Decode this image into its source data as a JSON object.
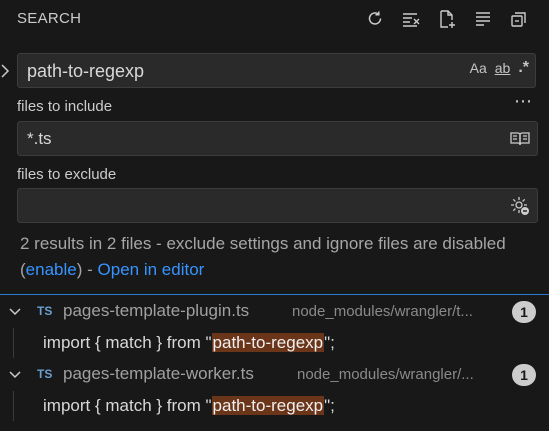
{
  "header": {
    "title": "SEARCH",
    "actions": [
      "refresh-icon",
      "clear-results-icon",
      "new-search-editor-icon",
      "view-as-tree-icon",
      "collapse-all-icon"
    ]
  },
  "search": {
    "query": "path-to-regexp",
    "match_case_label": "Aa",
    "whole_word_label": "ab",
    "regex_label": ".*"
  },
  "more_label": "⋯",
  "include": {
    "label": "files to include",
    "value": "*.ts"
  },
  "exclude": {
    "label": "files to exclude",
    "value": ""
  },
  "message": {
    "text": "2 results in 2 files - exclude settings and ignore files are disabled (",
    "enable_link": "enable",
    "middle": ") - ",
    "open_link": "Open in editor"
  },
  "results": [
    {
      "lang": "TS",
      "file": "pages-template-plugin.ts",
      "path": "node_modules/wrangler/t...",
      "count": "1",
      "line_prefix": "import { match } from \"",
      "match": "path-to-regexp",
      "line_suffix": "\";"
    },
    {
      "lang": "TS",
      "file": "pages-template-worker.ts",
      "path": "node_modules/wrangler/...",
      "count": "1",
      "line_prefix": "import { match } from \"",
      "match": "path-to-regexp",
      "line_suffix": "\";"
    }
  ],
  "colors": {
    "background": "#181818",
    "link": "#3794ff",
    "match_highlight": "#6b3519",
    "focus_border": "#2b79d0"
  }
}
